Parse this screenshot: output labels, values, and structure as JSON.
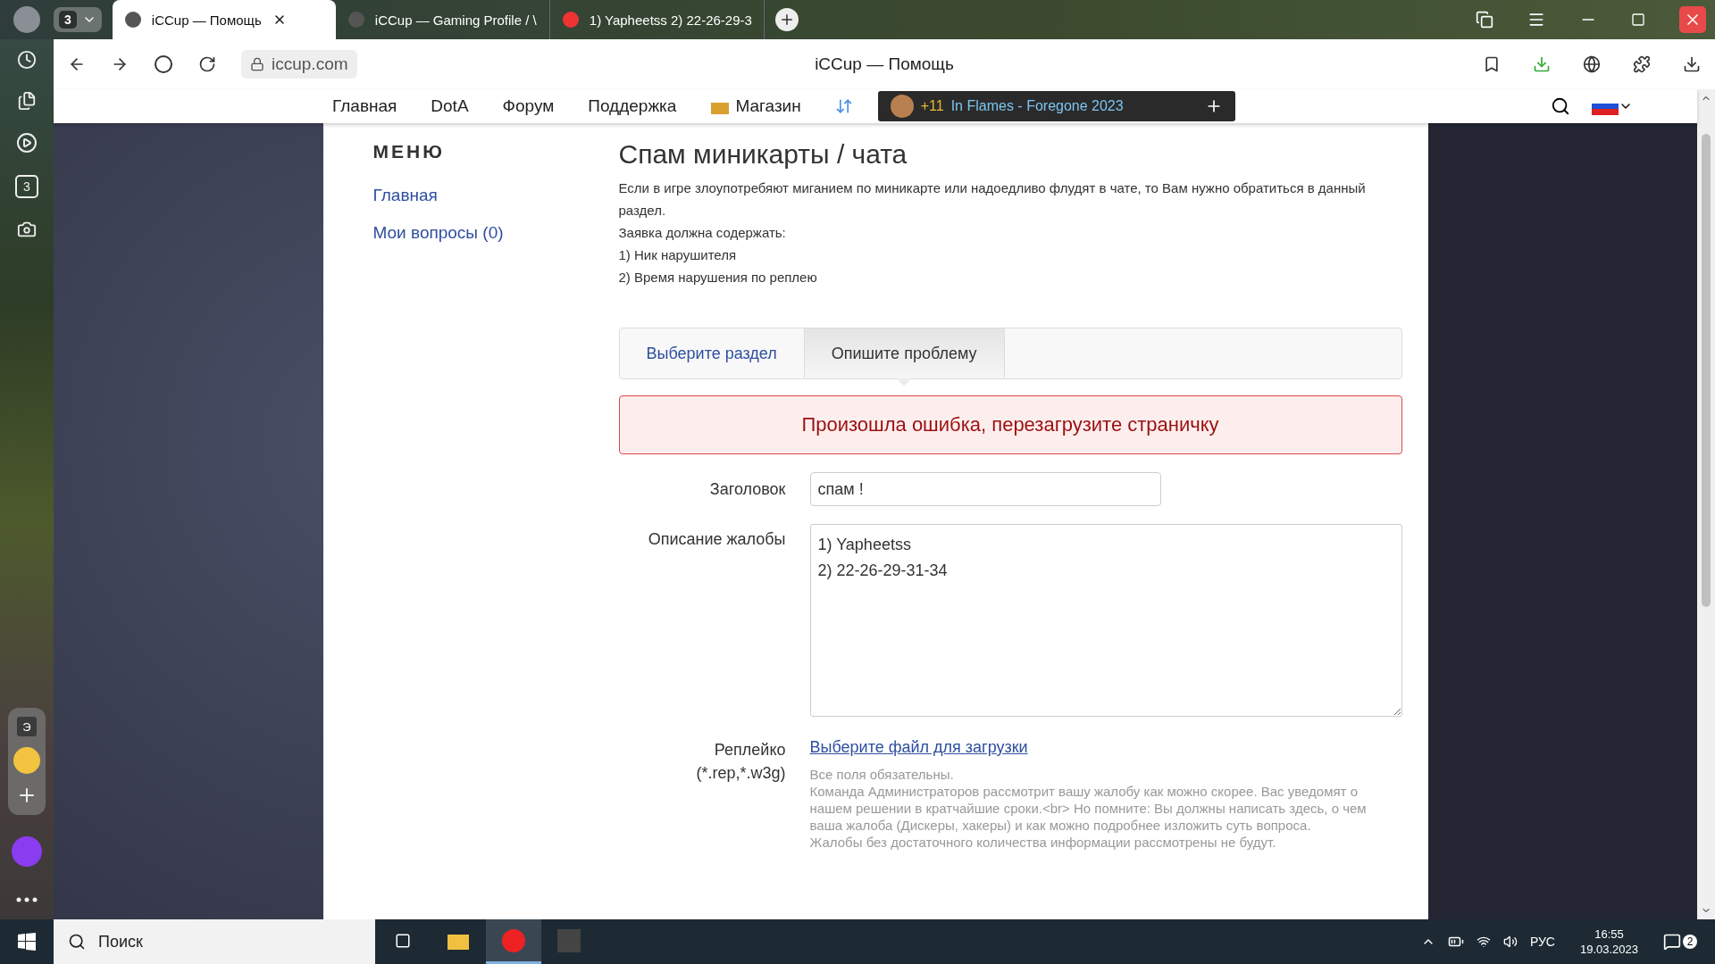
{
  "browser": {
    "tab_count": "3",
    "tabs": [
      {
        "title": "iCCup — Помощь",
        "selected": true
      },
      {
        "title": "iCCup — Gaming Profile / \\",
        "selected": false
      },
      {
        "title": "1) Yapheetss 2) 22-26-29-3",
        "selected": false
      }
    ],
    "address": "iccup.com",
    "page_title": "iCCup — Помощь"
  },
  "side_panel": {
    "tab_count": "3",
    "widget_letter": "Э"
  },
  "site_nav": {
    "items": [
      "Главная",
      "DotA",
      "Форум",
      "Поддержка"
    ],
    "shop": "Магазин",
    "player": {
      "count": "+11",
      "track": "In Flames - Foregone 2023"
    }
  },
  "menu": {
    "title": "МЕНЮ",
    "links": [
      "Главная",
      "Мои вопросы (0)"
    ]
  },
  "article": {
    "title": "Спам миникарты / чата",
    "lines": [
      "Если в игре злоупотребяют миганием по миникарте или надоедливо флудят в чате, то Вам нужно обратиться в данный раздел.",
      "Заявка должна содержать:",
      "1) Ник нарушителя",
      "2) Время нарушения по реплею"
    ]
  },
  "steps": [
    {
      "label": "Выберите раздел",
      "selected": false
    },
    {
      "label": "Опишите проблему",
      "selected": true
    }
  ],
  "error": "Произошла ошибка, перезагрузите страничку",
  "form": {
    "fields": [
      {
        "kind": "input",
        "label": "Заголовок",
        "value": "спам !"
      },
      {
        "kind": "textarea",
        "label": "Описание жалобы",
        "value": "1) Yapheetss\n2) 22-26-29-31-34"
      }
    ],
    "upload": {
      "label": [
        "Реплейко",
        "(*.rep,*.w3g)"
      ],
      "link": "Выберите файл для загрузки"
    },
    "notes": [
      "Все поля обязательны.",
      "Команда Администраторов рассмотрит вашу жалобу как можно скорее. Вас уведомят о нашем решении в кратчайшие сроки.<br> Но помните: Вы должны написать здесь, о чем ваша жалоба (Дискеры, хакеры) и как можно подробнее изложить суть вопроса.",
      "Жалобы без достаточного количества информации рассмотрены не будут."
    ]
  },
  "taskbar": {
    "search": "Поиск",
    "language": "РУС",
    "time": "16:55",
    "date": "19.03.2023",
    "notifications": "2"
  }
}
